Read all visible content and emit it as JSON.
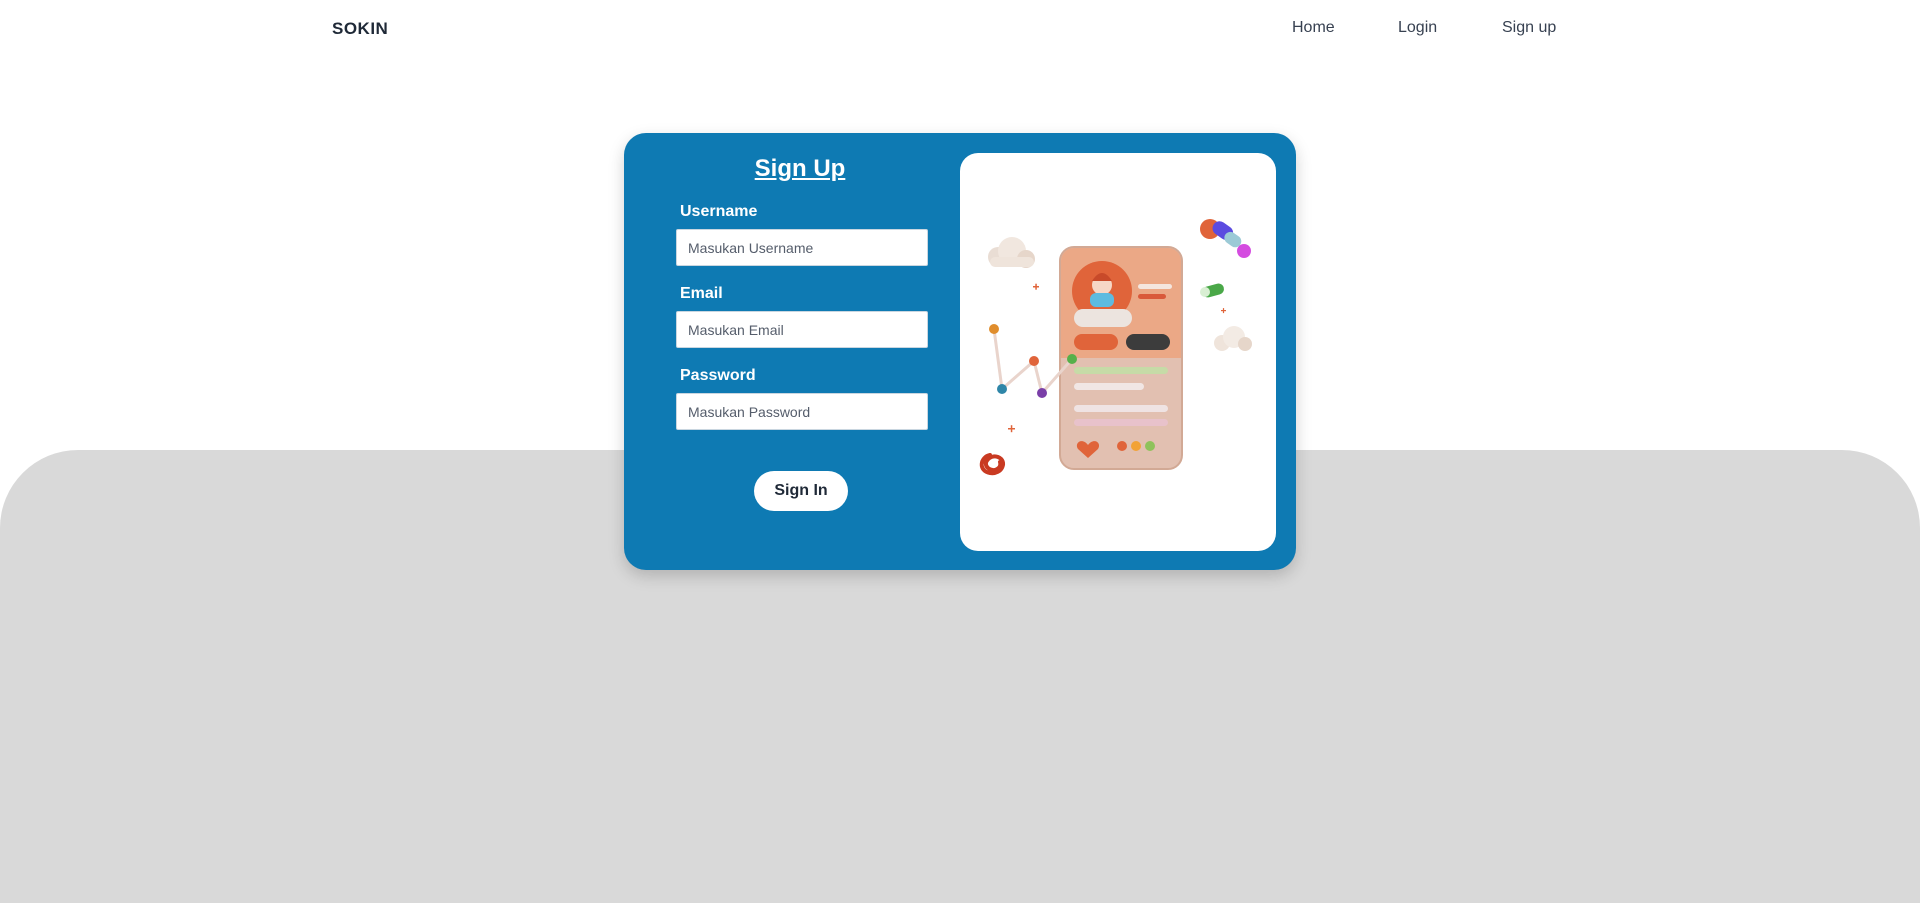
{
  "nav": {
    "brand": "SOKIN",
    "links": [
      "Home",
      "Login",
      "Sign up"
    ]
  },
  "form": {
    "title": "Sign Up",
    "username": {
      "label": "Username",
      "placeholder": "Masukan Username",
      "value": ""
    },
    "email": {
      "label": "Email",
      "placeholder": "Masukan Email",
      "value": ""
    },
    "password": {
      "label": "Password",
      "placeholder": "Masukan Password",
      "value": ""
    },
    "submit_label": "Sign In"
  },
  "colors": {
    "card_bg": "#0e7ab3",
    "panel_bg": "#d9d9d9",
    "accent_orange": "#e0643a"
  },
  "illustration": {
    "icon": "phone-profile-3d-illustration"
  }
}
